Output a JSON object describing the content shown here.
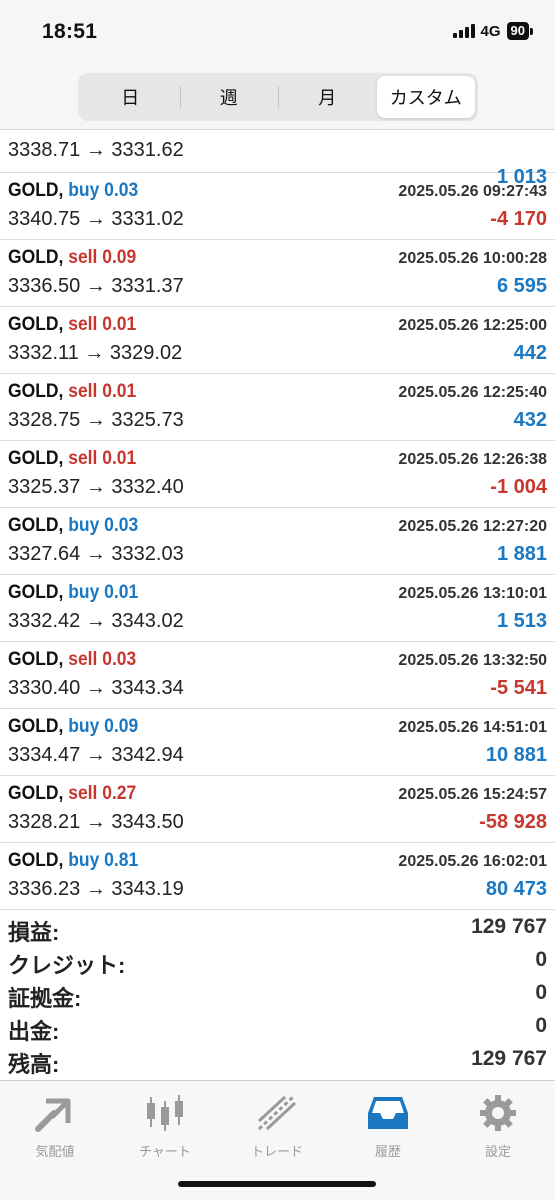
{
  "status": {
    "time": "18:51",
    "network": "4G",
    "battery": "90"
  },
  "tabs": [
    {
      "label": "日",
      "active": false
    },
    {
      "label": "週",
      "active": false
    },
    {
      "label": "月",
      "active": false
    },
    {
      "label": "カスタム",
      "active": true
    }
  ],
  "partial_row": {
    "prices": "3338.71 → 3331.62",
    "profit": "1 013"
  },
  "trades": [
    {
      "symbol": "GOLD,",
      "side": "buy 0.03",
      "type": "buy",
      "time": "2025.05.26 09:27:43",
      "prices": "3340.75 → 3331.02",
      "profit": "-4 170",
      "sign": "neg"
    },
    {
      "symbol": "GOLD,",
      "side": "sell 0.09",
      "type": "sell",
      "time": "2025.05.26 10:00:28",
      "prices": "3336.50 → 3331.37",
      "profit": "6 595",
      "sign": "pos"
    },
    {
      "symbol": "GOLD,",
      "side": "sell 0.01",
      "type": "sell",
      "time": "2025.05.26 12:25:00",
      "prices": "3332.11 → 3329.02",
      "profit": "442",
      "sign": "pos"
    },
    {
      "symbol": "GOLD,",
      "side": "sell 0.01",
      "type": "sell",
      "time": "2025.05.26 12:25:40",
      "prices": "3328.75 → 3325.73",
      "profit": "432",
      "sign": "pos"
    },
    {
      "symbol": "GOLD,",
      "side": "sell 0.01",
      "type": "sell",
      "time": "2025.05.26 12:26:38",
      "prices": "3325.37 → 3332.40",
      "profit": "-1 004",
      "sign": "neg"
    },
    {
      "symbol": "GOLD,",
      "side": "buy 0.03",
      "type": "buy",
      "time": "2025.05.26 12:27:20",
      "prices": "3327.64 → 3332.03",
      "profit": "1 881",
      "sign": "pos"
    },
    {
      "symbol": "GOLD,",
      "side": "buy 0.01",
      "type": "buy",
      "time": "2025.05.26 13:10:01",
      "prices": "3332.42 → 3343.02",
      "profit": "1 513",
      "sign": "pos"
    },
    {
      "symbol": "GOLD,",
      "side": "sell 0.03",
      "type": "sell",
      "time": "2025.05.26 13:32:50",
      "prices": "3330.40 → 3343.34",
      "profit": "-5 541",
      "sign": "neg"
    },
    {
      "symbol": "GOLD,",
      "side": "buy 0.09",
      "type": "buy",
      "time": "2025.05.26 14:51:01",
      "prices": "3334.47 → 3342.94",
      "profit": "10 881",
      "sign": "pos"
    },
    {
      "symbol": "GOLD,",
      "side": "sell 0.27",
      "type": "sell",
      "time": "2025.05.26 15:24:57",
      "prices": "3328.21 → 3343.50",
      "profit": "-58 928",
      "sign": "neg"
    },
    {
      "symbol": "GOLD,",
      "side": "buy 0.81",
      "type": "buy",
      "time": "2025.05.26 16:02:01",
      "prices": "3336.23 → 3343.19",
      "profit": "80 473",
      "sign": "pos"
    }
  ],
  "summary": [
    {
      "key": "損益:",
      "value": "129 767"
    },
    {
      "key": "クレジット:",
      "value": "0"
    },
    {
      "key": "証拠金:",
      "value": "0"
    },
    {
      "key": "出金:",
      "value": "0"
    },
    {
      "key": "残高:",
      "value": "129 767"
    }
  ],
  "nav": [
    {
      "label": "気配値",
      "icon": "quotes-arrows-icon",
      "active": false
    },
    {
      "label": "チャート",
      "icon": "candlestick-chart-icon",
      "active": false
    },
    {
      "label": "トレード",
      "icon": "trade-line-icon",
      "active": false
    },
    {
      "label": "履歴",
      "icon": "history-inbox-icon",
      "active": true
    },
    {
      "label": "設定",
      "icon": "gear-icon",
      "active": false
    }
  ],
  "colors": {
    "buy": "#1a78c2",
    "sell": "#c8372d",
    "active_tab": "#1a78c2"
  }
}
